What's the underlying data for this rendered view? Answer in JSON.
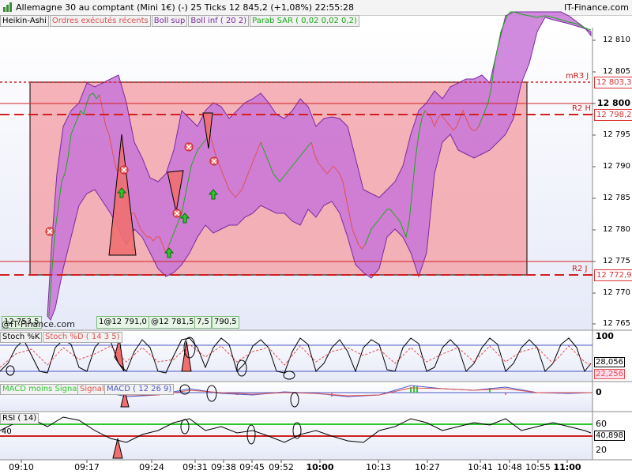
{
  "window": {
    "title": "Allemagne 30 au comptant (Mini 1€) (-)   25 Ticks   12 845,2 (+1,08%)   22:55:28",
    "brand": "IT-Finance.com"
  },
  "main_legend": [
    {
      "label": "Heikin-Ashi",
      "color": "#000000"
    },
    {
      "label": "Ordres exécutés récents",
      "color": "#e05050"
    },
    {
      "label": "Boll sup",
      "color": "#7a2aa0"
    },
    {
      "label": "Boll inf ( 20 2)",
      "color": "#7a2aa0"
    },
    {
      "label": "Parab SAR ( 0,02 0,02 0,2)",
      "color": "#1aaa1a"
    }
  ],
  "price_axis": {
    "ticks": [
      "12 810",
      "12 805",
      "12 800",
      "12 795",
      "12 790",
      "12 785",
      "12 780",
      "12 775",
      "12 770",
      "12 765"
    ],
    "highlight": "12 800"
  },
  "levels": [
    {
      "label": "mR3 J",
      "value": "12 803,3",
      "color": "#d02020"
    },
    {
      "label": "R2 H",
      "value": "12 798,2",
      "color": "#d02020"
    },
    {
      "label": "R2 J",
      "value": "12 772,9",
      "color": "#d02020"
    }
  ],
  "watermark": "@IT-Finance.com",
  "bottom_tags": [
    "12 753,5",
    "1@12 791,0",
    "@12 781,5",
    "7,5",
    "790,5"
  ],
  "stoch": {
    "legend_k": "Stoch %K",
    "legend_d": "Stoch %D ( 14 3 5)",
    "axis_top": "100",
    "value_k": "28,056",
    "value_d": "22,256"
  },
  "macd": {
    "legend_a": "MACD moins Signal",
    "legend_b": "Signal",
    "legend_c": "MACD ( 12 26 9)",
    "axis_zero": "0"
  },
  "rsi": {
    "legend": "RSI ( 14)",
    "axis_60": "60",
    "axis_20": "20",
    "value": "40,898",
    "left_val": "40"
  },
  "time_axis": [
    {
      "label": "09:10",
      "bold": false
    },
    {
      "label": "09:17",
      "bold": false
    },
    {
      "label": "09:24",
      "bold": false
    },
    {
      "label": "09:31",
      "bold": false
    },
    {
      "label": "09:38",
      "bold": false
    },
    {
      "label": "09:45",
      "bold": false
    },
    {
      "label": "09:52",
      "bold": false
    },
    {
      "label": "10:00",
      "bold": true
    },
    {
      "label": "10:13",
      "bold": false
    },
    {
      "label": "10:27",
      "bold": false
    },
    {
      "label": "10:41",
      "bold": false
    },
    {
      "label": "10:48",
      "bold": false
    },
    {
      "label": "10:55",
      "bold": false
    },
    {
      "label": "11:00",
      "bold": true
    }
  ],
  "colors": {
    "zone_fill": "#f4a0a6",
    "band_fill": "#c875d8",
    "up": "#1aaa1a",
    "down": "#e05050",
    "level": "#d02020",
    "axis_bg": "#ffffff"
  }
}
